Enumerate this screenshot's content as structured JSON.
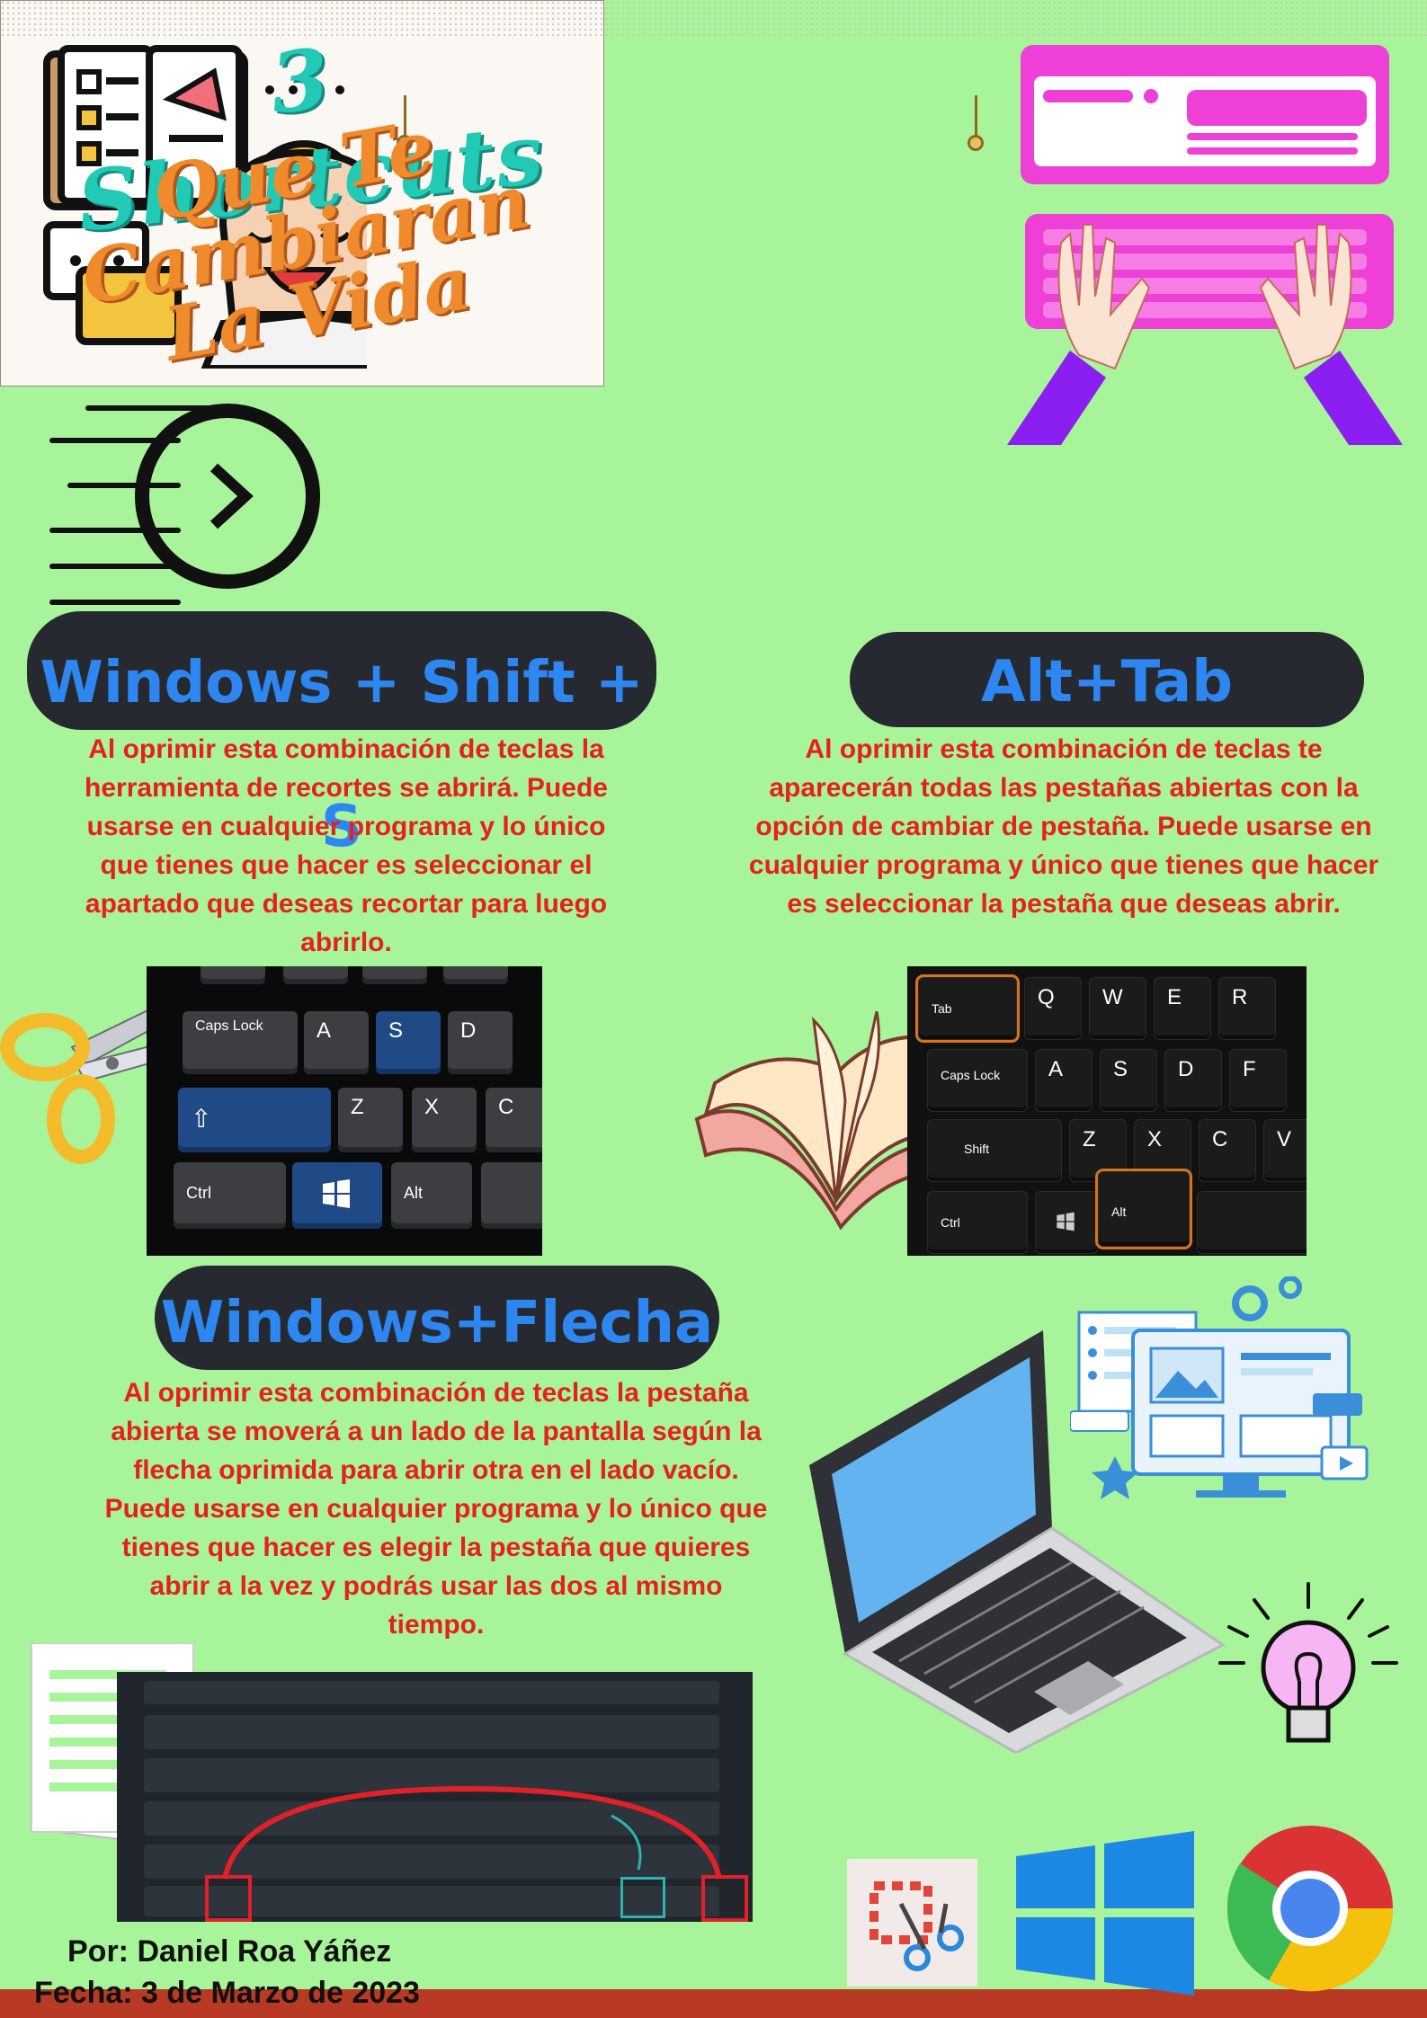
{
  "title": {
    "line1": "3 Shortcuts",
    "line2": "Que Te Cambiaran La Vida"
  },
  "sections": [
    {
      "heading": "Windows + Shift + S",
      "body": "Al oprimir esta combinación de teclas la herramienta de recortes se abrirá. Puede usarse en cualquier programa y lo único que tienes que hacer es seleccionar el apartado que deseas recortar para luego abrirlo."
    },
    {
      "heading": "Alt+Tab",
      "body": "Al oprimir esta combinación de teclas te aparecerán todas las pestañas abiertas con la opción de cambiar de pestaña. Puede usarse en cualquier programa  y único que tienes que hacer es seleccionar la pestaña que deseas abrir."
    },
    {
      "heading": "Windows+Flecha",
      "body": "Al oprimir esta combinación de teclas la pestaña abierta se moverá a un lado de la pantalla según la flecha oprimida para abrir otra en el lado vacío. Puede usarse en cualquier programa y lo único que tienes que hacer es elegir la pestaña que quieres  abrir a la vez y podrás usar las dos al mismo tiempo."
    }
  ],
  "keyboard1": {
    "keys": [
      "Caps Lock",
      "A",
      "S",
      "D",
      "⇧",
      "Z",
      "X",
      "C",
      "Ctrl",
      "Alt"
    ]
  },
  "keyboard2": {
    "keys": [
      "Tab",
      "Q",
      "W",
      "E",
      "R",
      "Caps Lock",
      "A",
      "S",
      "D",
      "F",
      "Shift",
      "Z",
      "X",
      "C",
      "V",
      "Ctrl",
      "Alt"
    ]
  },
  "footer": {
    "author": "Por: Daniel Roa Yáñez",
    "date": "Fecha: 3 de Marzo de 2023"
  },
  "colors": {
    "background": "#a8f49a",
    "pill": "#262a30",
    "heading": "#2e86f0",
    "body": "#e8201c",
    "accent_pink": "#ee3fd6",
    "accent_purple": "#8b1ef0"
  }
}
